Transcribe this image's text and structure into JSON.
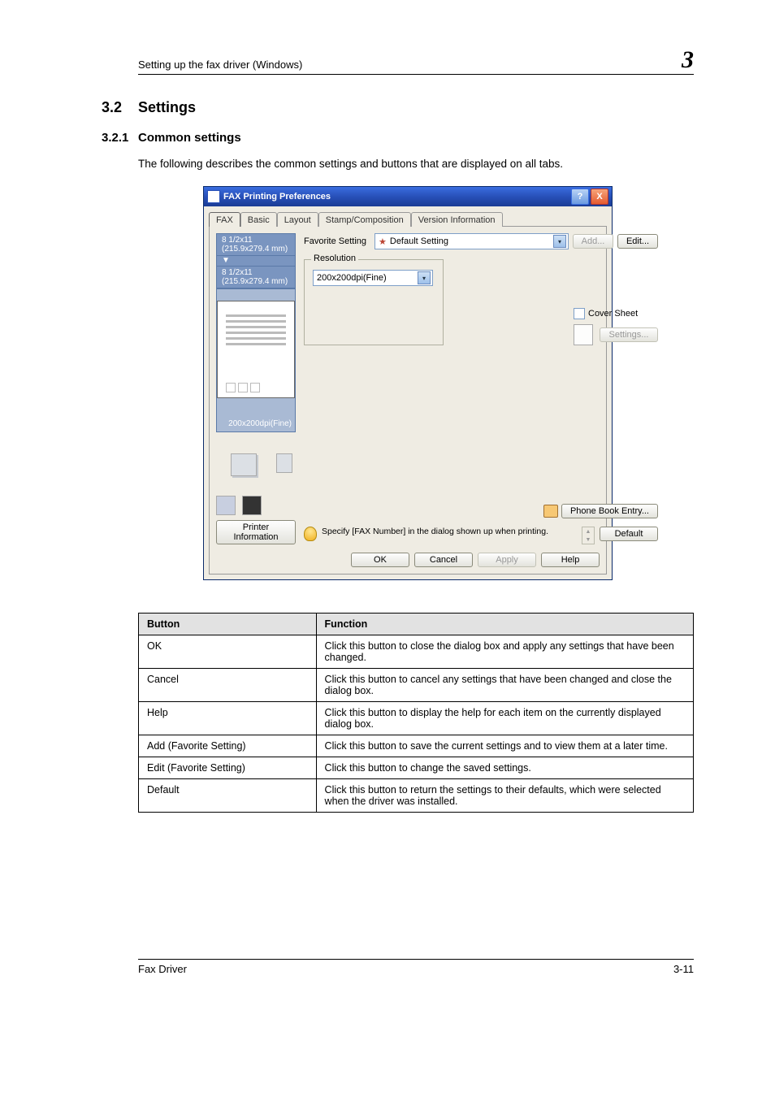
{
  "header": {
    "section_title": "Setting up the fax driver (Windows)",
    "chapter_number": "3"
  },
  "h2": {
    "num": "3.2",
    "title": "Settings"
  },
  "h3": {
    "num": "3.2.1",
    "title": "Common settings"
  },
  "intro": "The following describes the common settings and buttons that are displayed on all tabs.",
  "dialog": {
    "title": "FAX Printing Preferences",
    "help_btn": "?",
    "close_btn": "X",
    "tabs": {
      "fax": "FAX",
      "basic": "Basic",
      "layout": "Layout",
      "stamp": "Stamp/Composition",
      "version": "Version Information"
    },
    "preview": {
      "size_a": "8 1/2x11 (215.9x279.4 mm)",
      "arrow": "▼",
      "size_b": "8 1/2x11 (215.9x279.4 mm)",
      "dpi": "200x200dpi(Fine)"
    },
    "printer_info": "Printer Information",
    "favorite": {
      "label": "Favorite Setting",
      "value": "Default Setting",
      "add": "Add...",
      "edit": "Edit..."
    },
    "resolution": {
      "legend": "Resolution",
      "value": "200x200dpi(Fine)"
    },
    "cover": {
      "label": "Cover Sheet",
      "settings": "Settings..."
    },
    "phonebook": "Phone Book Entry...",
    "hint": "Specify [FAX Number] in the dialog shown up when printing.",
    "default": "Default",
    "footer": {
      "ok": "OK",
      "cancel": "Cancel",
      "apply": "Apply",
      "help": "Help"
    }
  },
  "table": {
    "head": {
      "c1": "Button",
      "c2": "Function"
    },
    "rows": [
      {
        "c1": "OK",
        "c2": "Click this button to close the dialog box and apply any settings that have been changed."
      },
      {
        "c1": "Cancel",
        "c2": "Click this button to cancel any settings that have been changed and close the dialog box."
      },
      {
        "c1": "Help",
        "c2": "Click this button to display the help for each item on the currently displayed dialog box."
      },
      {
        "c1": "Add (Favorite Setting)",
        "c2": "Click this button to save the current settings and to view them at a later time."
      },
      {
        "c1": "Edit (Favorite Setting)",
        "c2": "Click this button to change the saved settings."
      },
      {
        "c1": "Default",
        "c2": "Click this button to return the settings to their defaults, which were selected when the driver was installed."
      }
    ]
  },
  "footer": {
    "left": "Fax Driver",
    "right": "3-11"
  }
}
